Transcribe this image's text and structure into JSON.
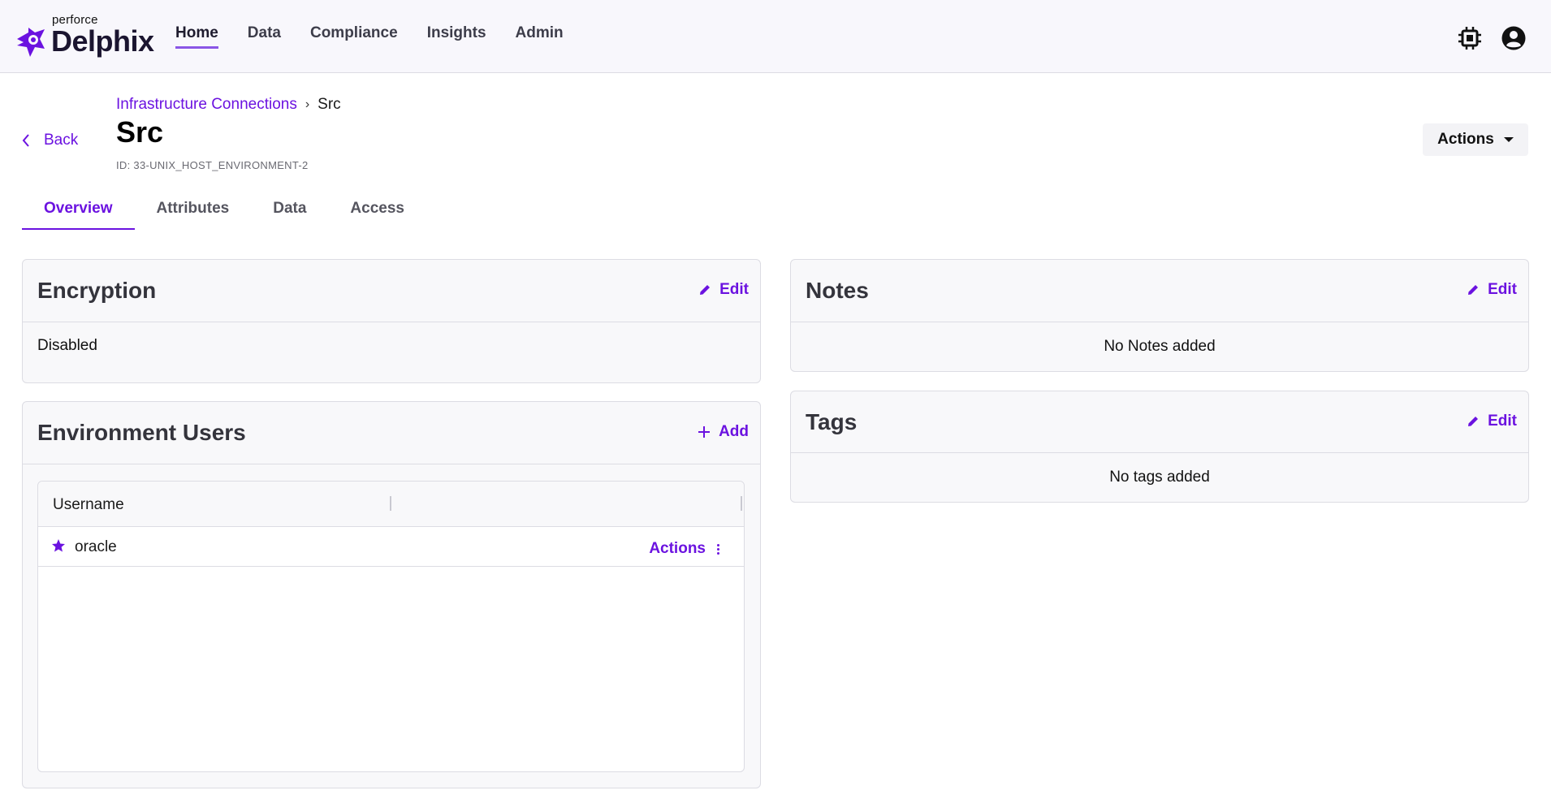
{
  "brand": {
    "small": "perforce",
    "big": "Delphix",
    "accent": "#6b12e0"
  },
  "nav": {
    "items": [
      {
        "label": "Home",
        "active": true
      },
      {
        "label": "Data",
        "active": false
      },
      {
        "label": "Compliance",
        "active": false
      },
      {
        "label": "Insights",
        "active": false
      },
      {
        "label": "Admin",
        "active": false
      }
    ],
    "icons": [
      "chip-icon",
      "user-account-icon"
    ]
  },
  "header": {
    "back_label": "Back",
    "breadcrumb": {
      "parent": "Infrastructure Connections",
      "current": "Src"
    },
    "title": "Src",
    "id_text": "ID: 33-UNIX_HOST_ENVIRONMENT-2",
    "actions_label": "Actions"
  },
  "tabs": [
    {
      "label": "Overview",
      "active": true
    },
    {
      "label": "Attributes",
      "active": false
    },
    {
      "label": "Data",
      "active": false
    },
    {
      "label": "Access",
      "active": false
    }
  ],
  "encryption": {
    "title": "Encryption",
    "edit_label": "Edit",
    "value": "Disabled"
  },
  "environment_users": {
    "title": "Environment Users",
    "add_label": "Add",
    "columns": [
      "Username"
    ],
    "rows": [
      {
        "username": "oracle",
        "primary": true,
        "actions_label": "Actions"
      }
    ]
  },
  "notes": {
    "title": "Notes",
    "edit_label": "Edit",
    "empty_text": "No Notes added"
  },
  "tags": {
    "title": "Tags",
    "edit_label": "Edit",
    "empty_text": "No tags added"
  }
}
